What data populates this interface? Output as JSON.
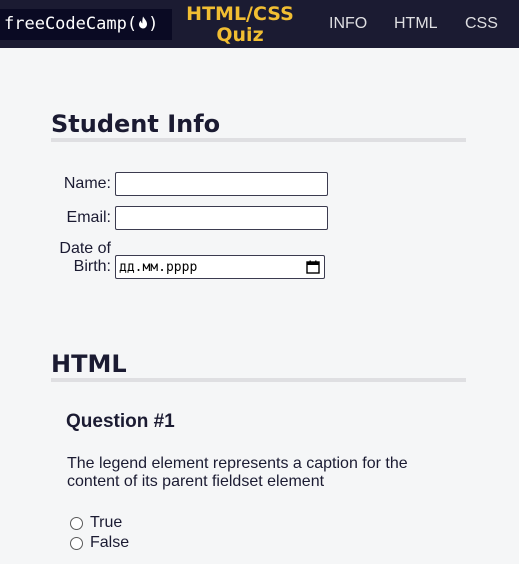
{
  "header": {
    "logo_text": "freeCodeCamp(",
    "logo_text_end": ")",
    "title": "HTML/CSS Quiz",
    "nav": [
      {
        "label": "INFO"
      },
      {
        "label": "HTML"
      },
      {
        "label": "CSS"
      }
    ]
  },
  "student_info": {
    "heading": "Student Info",
    "name_label": "Name:",
    "name_value": "",
    "email_label": "Email:",
    "email_value": "",
    "dob_label": "Date of Birth:",
    "dob_placeholder": "дд.мм.рррр"
  },
  "html_section": {
    "heading": "HTML",
    "question": {
      "title": "Question #1",
      "text": "The legend element represents a caption for the content of its parent fieldset element",
      "options": [
        {
          "label": "True",
          "selected": false
        },
        {
          "label": "False",
          "selected": false
        }
      ]
    }
  },
  "colors": {
    "header_bg": "#1b1b32",
    "logo_bg": "#0a0a23",
    "accent": "#f1be32",
    "page_bg": "#f5f6f7",
    "nav_text": "#dfdfe2"
  },
  "icons": {
    "logo": "fcc-flame-icon",
    "date": "calendar-icon"
  }
}
